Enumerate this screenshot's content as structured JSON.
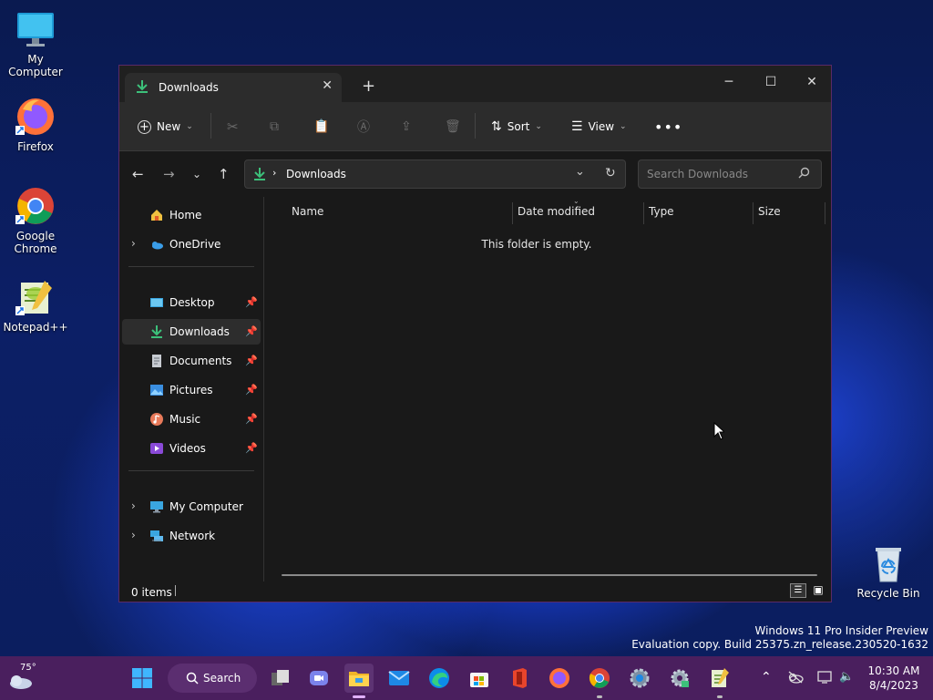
{
  "desktop": {
    "icons": [
      {
        "label": "My Computer"
      },
      {
        "label": "Firefox"
      },
      {
        "label": "Google Chrome"
      },
      {
        "label": "Notepad++"
      },
      {
        "label": "Recycle Bin"
      }
    ],
    "watermark_line1": "Windows 11 Pro Insider Preview",
    "watermark_line2": "Evaluation copy. Build 25375.zn_release.230520-1632"
  },
  "window": {
    "tab_title": "Downloads",
    "toolbar": {
      "new_label": "New",
      "sort_label": "Sort",
      "view_label": "View"
    },
    "address": {
      "current": "Downloads",
      "search_placeholder": "Search Downloads"
    },
    "sidebar": {
      "top_items": [
        {
          "label": "Home",
          "icon": "home-icon"
        },
        {
          "label": "OneDrive",
          "icon": "cloud-icon"
        }
      ],
      "pinned_items": [
        {
          "label": "Desktop",
          "icon": "desktop-icon"
        },
        {
          "label": "Downloads",
          "icon": "download-icon"
        },
        {
          "label": "Documents",
          "icon": "document-icon"
        },
        {
          "label": "Pictures",
          "icon": "pictures-icon"
        },
        {
          "label": "Music",
          "icon": "music-icon"
        },
        {
          "label": "Videos",
          "icon": "video-icon"
        }
      ],
      "bottom_items": [
        {
          "label": "My Computer",
          "icon": "computer-icon"
        },
        {
          "label": "Network",
          "icon": "network-icon"
        }
      ]
    },
    "columns": [
      "Name",
      "Date modified",
      "Type",
      "Size"
    ],
    "empty_message": "This folder is empty.",
    "status": "0 items"
  },
  "taskbar": {
    "weather_temp": "75°",
    "search_label": "Search",
    "time": "10:30 AM",
    "date": "8/4/2023"
  },
  "colors": {
    "accent_download": "#3cc07a",
    "taskbar": "#4a1f5e",
    "window_border": "#5a2a66"
  }
}
